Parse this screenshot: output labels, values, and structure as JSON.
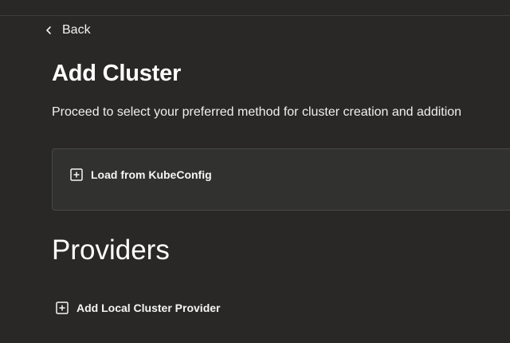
{
  "nav": {
    "back_label": "Back"
  },
  "header": {
    "title": "Add Cluster",
    "subtitle": "Proceed to select your preferred method for cluster creation and addition"
  },
  "card": {
    "load_label": "Load from KubeConfig"
  },
  "providers": {
    "heading": "Providers",
    "add_local_label": "Add Local Cluster Provider"
  },
  "colors": {
    "background": "#292827",
    "card_background": "#313130",
    "card_border": "#484746",
    "text": "#f2f2f2"
  },
  "icons": [
    "chevron-left-icon",
    "plus-square-icon"
  ]
}
